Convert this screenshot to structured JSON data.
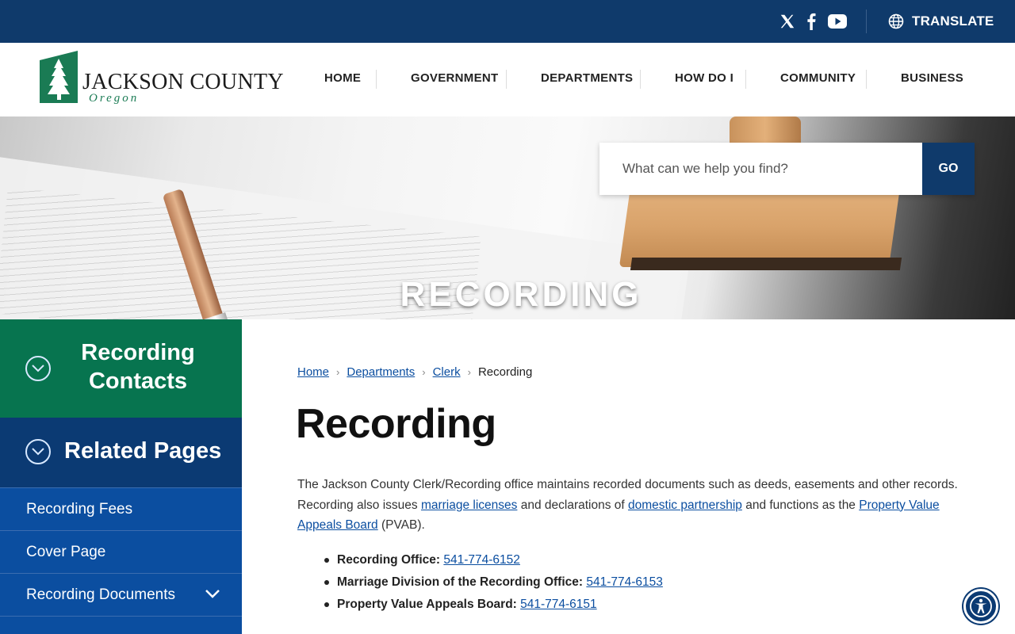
{
  "topbar": {
    "social": [
      "x-icon",
      "facebook-icon",
      "youtube-icon"
    ],
    "translate_label": "TRANSLATE"
  },
  "header": {
    "logo_name": "JACKSON COUNTY",
    "logo_sub": "Oregon",
    "nav": [
      "HOME",
      "GOVERNMENT",
      "DEPARTMENTS",
      "HOW DO I",
      "COMMUNITY",
      "BUSINESS"
    ]
  },
  "hero": {
    "title": "RECORDING",
    "search_placeholder": "What can we help you find?",
    "search_button": "GO"
  },
  "sidebar": {
    "contacts_title": "Recording Contacts",
    "related_title": "Related Pages",
    "items": [
      {
        "label": "Recording Fees"
      },
      {
        "label": "Cover Page"
      },
      {
        "label": "Recording Documents"
      }
    ]
  },
  "main": {
    "breadcrumb": [
      "Home",
      "Departments",
      "Clerk",
      "Recording"
    ],
    "title": "Recording",
    "intro_1": "The Jackson County Clerk/Recording office maintains recorded documents such as deeds, easements and other records. Recording also issues ",
    "link_marriage": "marriage licenses",
    "intro_2": " and declarations of ",
    "link_domestic": "domestic partnership",
    "intro_3": " and functions as the ",
    "link_pvab": "Property Value Appeals Board",
    "intro_4": " (PVAB).",
    "contacts": [
      {
        "label": "Recording Office:",
        "phone": "541-774-6152"
      },
      {
        "label": "Marriage Division of the Recording Office:",
        "phone": "541-774-6153"
      },
      {
        "label": "Property Value Appeals Board:",
        "phone": "541-774-6151"
      }
    ]
  },
  "colors": {
    "topbar": "#0f3a6b",
    "contacts_green": "#07744f",
    "related_navy": "#0b3a73",
    "sidebar_blue": "#0b4ea0",
    "link": "#0b4ea0"
  }
}
